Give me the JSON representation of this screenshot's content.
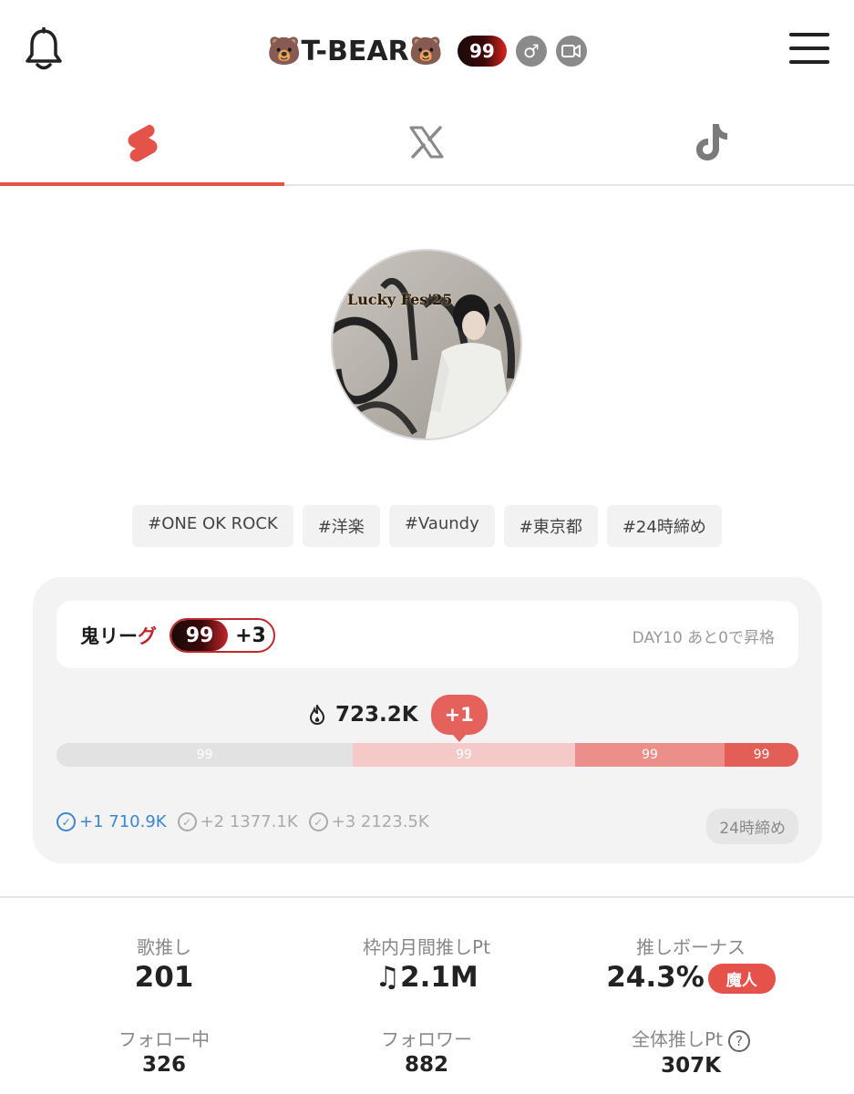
{
  "header": {
    "title": "🐻T-BEAR🐻",
    "level_badge": "99",
    "gender_icon": "male-icon",
    "video_icon": "video-camera-icon"
  },
  "tabs": [
    {
      "name": "youtube-shorts",
      "icon": "shorts-icon",
      "active": true
    },
    {
      "name": "x",
      "icon": "x-logo-icon",
      "active": false
    },
    {
      "name": "tiktok",
      "icon": "tiktok-icon",
      "active": false
    }
  ],
  "profile": {
    "avatar_caption": "Lucky Fes'25"
  },
  "tags": [
    "#ONE OK ROCK",
    "#洋楽",
    "#Vaundy",
    "#東京都",
    "#24時締め"
  ],
  "league": {
    "name_prefix": "鬼リー",
    "name_suffix": "グ",
    "level": "99",
    "plus": "+3",
    "status": "DAY10 あと0で昇格",
    "score": "723.2K",
    "score_delta": "+1",
    "bar_labels": [
      "99",
      "99",
      "99",
      "99"
    ],
    "milestones": [
      {
        "label": "+1 710.9K",
        "done": true
      },
      {
        "label": "+2 1377.1K",
        "done": false
      },
      {
        "label": "+3 2123.5K",
        "done": false
      }
    ],
    "deadline": "24時締め"
  },
  "stats": {
    "songs_label": "歌推し",
    "songs_value": "201",
    "monthly_label": "枠内月間推しPt",
    "monthly_value": "2.1M",
    "bonus_label": "推しボーナス",
    "bonus_value": "24.3%",
    "bonus_badge": "魔人",
    "following_label": "フォロー中",
    "following_value": "326",
    "followers_label": "フォロワー",
    "followers_value": "882",
    "total_label": "全体推しPt",
    "total_value": "307K"
  },
  "colors": {
    "accent": "#e5524a",
    "league_red": "#c0272d",
    "milestone_done": "#3a86d1"
  }
}
